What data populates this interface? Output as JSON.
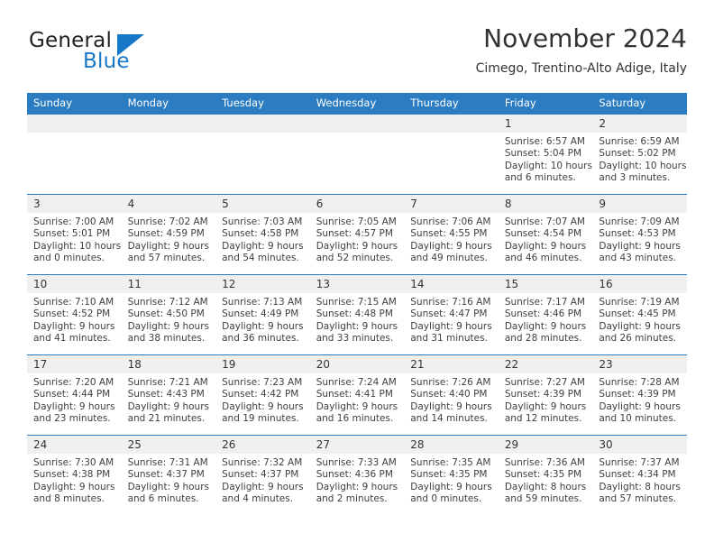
{
  "brand": {
    "name_part1": "General",
    "name_part2": "Blue",
    "logo_icon": "triangle-logo-icon",
    "accent_color": "#1878c8"
  },
  "header": {
    "title": "November 2024",
    "subtitle": "Cimego, Trentino-Alto Adige, Italy"
  },
  "theme": {
    "header_row_color": "#2b7cc0",
    "day_band_color": "#f0f0f0",
    "text_color": "#3f3f3f"
  },
  "calendar": {
    "weekday_headers": [
      "Sunday",
      "Monday",
      "Tuesday",
      "Wednesday",
      "Thursday",
      "Friday",
      "Saturday"
    ],
    "weeks": [
      [
        {
          "date": "",
          "sunrise": "",
          "sunset": "",
          "daylight_line1": "",
          "daylight_line2": ""
        },
        {
          "date": "",
          "sunrise": "",
          "sunset": "",
          "daylight_line1": "",
          "daylight_line2": ""
        },
        {
          "date": "",
          "sunrise": "",
          "sunset": "",
          "daylight_line1": "",
          "daylight_line2": ""
        },
        {
          "date": "",
          "sunrise": "",
          "sunset": "",
          "daylight_line1": "",
          "daylight_line2": ""
        },
        {
          "date": "",
          "sunrise": "",
          "sunset": "",
          "daylight_line1": "",
          "daylight_line2": ""
        },
        {
          "date": "1",
          "sunrise": "Sunrise: 6:57 AM",
          "sunset": "Sunset: 5:04 PM",
          "daylight_line1": "Daylight: 10 hours",
          "daylight_line2": "and 6 minutes."
        },
        {
          "date": "2",
          "sunrise": "Sunrise: 6:59 AM",
          "sunset": "Sunset: 5:02 PM",
          "daylight_line1": "Daylight: 10 hours",
          "daylight_line2": "and 3 minutes."
        }
      ],
      [
        {
          "date": "3",
          "sunrise": "Sunrise: 7:00 AM",
          "sunset": "Sunset: 5:01 PM",
          "daylight_line1": "Daylight: 10 hours",
          "daylight_line2": "and 0 minutes."
        },
        {
          "date": "4",
          "sunrise": "Sunrise: 7:02 AM",
          "sunset": "Sunset: 4:59 PM",
          "daylight_line1": "Daylight: 9 hours",
          "daylight_line2": "and 57 minutes."
        },
        {
          "date": "5",
          "sunrise": "Sunrise: 7:03 AM",
          "sunset": "Sunset: 4:58 PM",
          "daylight_line1": "Daylight: 9 hours",
          "daylight_line2": "and 54 minutes."
        },
        {
          "date": "6",
          "sunrise": "Sunrise: 7:05 AM",
          "sunset": "Sunset: 4:57 PM",
          "daylight_line1": "Daylight: 9 hours",
          "daylight_line2": "and 52 minutes."
        },
        {
          "date": "7",
          "sunrise": "Sunrise: 7:06 AM",
          "sunset": "Sunset: 4:55 PM",
          "daylight_line1": "Daylight: 9 hours",
          "daylight_line2": "and 49 minutes."
        },
        {
          "date": "8",
          "sunrise": "Sunrise: 7:07 AM",
          "sunset": "Sunset: 4:54 PM",
          "daylight_line1": "Daylight: 9 hours",
          "daylight_line2": "and 46 minutes."
        },
        {
          "date": "9",
          "sunrise": "Sunrise: 7:09 AM",
          "sunset": "Sunset: 4:53 PM",
          "daylight_line1": "Daylight: 9 hours",
          "daylight_line2": "and 43 minutes."
        }
      ],
      [
        {
          "date": "10",
          "sunrise": "Sunrise: 7:10 AM",
          "sunset": "Sunset: 4:52 PM",
          "daylight_line1": "Daylight: 9 hours",
          "daylight_line2": "and 41 minutes."
        },
        {
          "date": "11",
          "sunrise": "Sunrise: 7:12 AM",
          "sunset": "Sunset: 4:50 PM",
          "daylight_line1": "Daylight: 9 hours",
          "daylight_line2": "and 38 minutes."
        },
        {
          "date": "12",
          "sunrise": "Sunrise: 7:13 AM",
          "sunset": "Sunset: 4:49 PM",
          "daylight_line1": "Daylight: 9 hours",
          "daylight_line2": "and 36 minutes."
        },
        {
          "date": "13",
          "sunrise": "Sunrise: 7:15 AM",
          "sunset": "Sunset: 4:48 PM",
          "daylight_line1": "Daylight: 9 hours",
          "daylight_line2": "and 33 minutes."
        },
        {
          "date": "14",
          "sunrise": "Sunrise: 7:16 AM",
          "sunset": "Sunset: 4:47 PM",
          "daylight_line1": "Daylight: 9 hours",
          "daylight_line2": "and 31 minutes."
        },
        {
          "date": "15",
          "sunrise": "Sunrise: 7:17 AM",
          "sunset": "Sunset: 4:46 PM",
          "daylight_line1": "Daylight: 9 hours",
          "daylight_line2": "and 28 minutes."
        },
        {
          "date": "16",
          "sunrise": "Sunrise: 7:19 AM",
          "sunset": "Sunset: 4:45 PM",
          "daylight_line1": "Daylight: 9 hours",
          "daylight_line2": "and 26 minutes."
        }
      ],
      [
        {
          "date": "17",
          "sunrise": "Sunrise: 7:20 AM",
          "sunset": "Sunset: 4:44 PM",
          "daylight_line1": "Daylight: 9 hours",
          "daylight_line2": "and 23 minutes."
        },
        {
          "date": "18",
          "sunrise": "Sunrise: 7:21 AM",
          "sunset": "Sunset: 4:43 PM",
          "daylight_line1": "Daylight: 9 hours",
          "daylight_line2": "and 21 minutes."
        },
        {
          "date": "19",
          "sunrise": "Sunrise: 7:23 AM",
          "sunset": "Sunset: 4:42 PM",
          "daylight_line1": "Daylight: 9 hours",
          "daylight_line2": "and 19 minutes."
        },
        {
          "date": "20",
          "sunrise": "Sunrise: 7:24 AM",
          "sunset": "Sunset: 4:41 PM",
          "daylight_line1": "Daylight: 9 hours",
          "daylight_line2": "and 16 minutes."
        },
        {
          "date": "21",
          "sunrise": "Sunrise: 7:26 AM",
          "sunset": "Sunset: 4:40 PM",
          "daylight_line1": "Daylight: 9 hours",
          "daylight_line2": "and 14 minutes."
        },
        {
          "date": "22",
          "sunrise": "Sunrise: 7:27 AM",
          "sunset": "Sunset: 4:39 PM",
          "daylight_line1": "Daylight: 9 hours",
          "daylight_line2": "and 12 minutes."
        },
        {
          "date": "23",
          "sunrise": "Sunrise: 7:28 AM",
          "sunset": "Sunset: 4:39 PM",
          "daylight_line1": "Daylight: 9 hours",
          "daylight_line2": "and 10 minutes."
        }
      ],
      [
        {
          "date": "24",
          "sunrise": "Sunrise: 7:30 AM",
          "sunset": "Sunset: 4:38 PM",
          "daylight_line1": "Daylight: 9 hours",
          "daylight_line2": "and 8 minutes."
        },
        {
          "date": "25",
          "sunrise": "Sunrise: 7:31 AM",
          "sunset": "Sunset: 4:37 PM",
          "daylight_line1": "Daylight: 9 hours",
          "daylight_line2": "and 6 minutes."
        },
        {
          "date": "26",
          "sunrise": "Sunrise: 7:32 AM",
          "sunset": "Sunset: 4:37 PM",
          "daylight_line1": "Daylight: 9 hours",
          "daylight_line2": "and 4 minutes."
        },
        {
          "date": "27",
          "sunrise": "Sunrise: 7:33 AM",
          "sunset": "Sunset: 4:36 PM",
          "daylight_line1": "Daylight: 9 hours",
          "daylight_line2": "and 2 minutes."
        },
        {
          "date": "28",
          "sunrise": "Sunrise: 7:35 AM",
          "sunset": "Sunset: 4:35 PM",
          "daylight_line1": "Daylight: 9 hours",
          "daylight_line2": "and 0 minutes."
        },
        {
          "date": "29",
          "sunrise": "Sunrise: 7:36 AM",
          "sunset": "Sunset: 4:35 PM",
          "daylight_line1": "Daylight: 8 hours",
          "daylight_line2": "and 59 minutes."
        },
        {
          "date": "30",
          "sunrise": "Sunrise: 7:37 AM",
          "sunset": "Sunset: 4:34 PM",
          "daylight_line1": "Daylight: 8 hours",
          "daylight_line2": "and 57 minutes."
        }
      ]
    ]
  }
}
